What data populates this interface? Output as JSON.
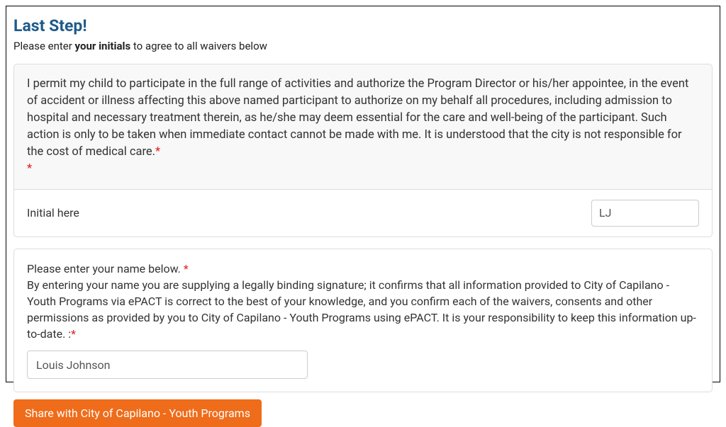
{
  "heading": "Last Step!",
  "subheading_prefix": "Please enter ",
  "subheading_bold": "your initials",
  "subheading_suffix": " to agree to all waivers below",
  "waiver": {
    "text": "I permit my child to participate in the full range of activities and authorize the Program Director or his/her appointee, in the event of accident or illness affecting this above named participant to authorize on my behalf all procedures, including admission to hospital and necessary treatment therein, as he/she may deem essential for the care and well-being of the participant. Such action is only to be taken when immediate contact cannot be made with me. It is understood that the city is not responsible for the cost of medical care.",
    "initial_label": "Initial here",
    "initial_value": "LJ"
  },
  "signature": {
    "prompt1": "Please enter your name below. ",
    "prompt2": "By entering your name you are supplying a legally binding signature; it confirms that all information provided to City of Capilano - Youth Programs via ePACT is correct to the best of your knowledge, and you confirm each of the waivers, consents and other permissions as provided by you to City of Capilano - Youth Programs using ePACT. It is your responsibility to keep this information up-to-date. :",
    "name_value": "Louis Johnson"
  },
  "share_button": "Share with City of Capilano - Youth Programs"
}
